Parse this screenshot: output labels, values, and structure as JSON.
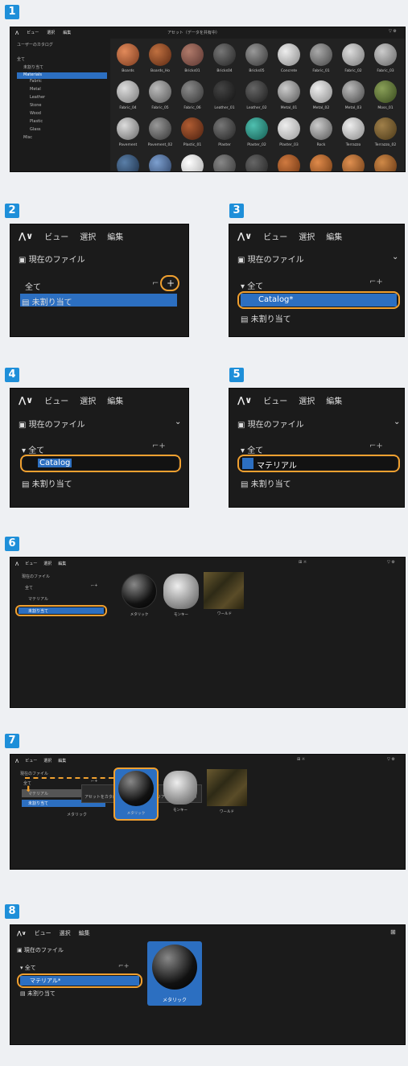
{
  "steps": [
    "1",
    "2",
    "3",
    "4",
    "5",
    "6",
    "7",
    "8"
  ],
  "s1": {
    "menu": [
      "ビュー",
      "選択",
      "編集"
    ],
    "title": "アセット（データを共有中）",
    "search_placeholder": "ユーザーのカタログ",
    "tree": [
      "全て",
      "未割り当て",
      "Materials",
      "Fabric",
      "Metal",
      "Leather",
      "Stone",
      "Wood",
      "Plastic",
      "Glass",
      "Misc"
    ],
    "materials_row1": [
      "Boards",
      "Boards_Ho",
      "Bricks01",
      "Bricks04",
      "Bricks05",
      "Concrete",
      "Fabric_01",
      "Fabric_02",
      "Fabric_03"
    ],
    "materials_row2": [
      "Fabric_04",
      "Fabric_05",
      "Fabric_06",
      "Leather_01",
      "Leather_02",
      "Metal_01",
      "Metal_02",
      "Metal_03",
      "Moss_01"
    ],
    "materials_row3": [
      "Pavement",
      "Pavement_02",
      "Plastic_01",
      "Plaster",
      "Plaster_02",
      "Plaster_03",
      "Rock",
      "Terrazzo",
      "Terrazzo_02"
    ]
  },
  "s2": {
    "menu": [
      "ビュー",
      "選択",
      "編集"
    ],
    "file": "現在のファイル",
    "all": "全て",
    "unassigned": "未割り当て"
  },
  "s3": {
    "menu": [
      "ビュー",
      "選択",
      "編集"
    ],
    "file": "現在のファイル",
    "all": "全て",
    "catalog": "Catalog*",
    "unassigned": "未割り当て"
  },
  "s4": {
    "menu": [
      "ビュー",
      "選択",
      "編集"
    ],
    "file": "現在のファイル",
    "all": "全て",
    "catalog": "Catalog",
    "unassigned": "未割り当て"
  },
  "s5": {
    "menu": [
      "ビュー",
      "選択",
      "編集"
    ],
    "file": "現在のファイル",
    "all": "全て",
    "catalog": "マテリアル",
    "unassigned": "未割り当て"
  },
  "s6": {
    "menu": [
      "ビュー",
      "選択",
      "編集"
    ],
    "file": "現在のファイル",
    "all": "全て",
    "catalog": "マテリアル",
    "unassigned": "未割り当て",
    "assets": [
      "メタリック",
      "モンキー",
      "ワールド"
    ]
  },
  "s7": {
    "menu": [
      "ビュー",
      "選択",
      "編集"
    ],
    "file": "現在のファイル",
    "all": "全て",
    "catalog": "マテリアル",
    "unassigned": "未割り当て",
    "tooltip": "アセットをカタログに移動します（マテリアル（ダイアログ））",
    "dragging": "メタリック",
    "assets": [
      "メタリック",
      "モンキー",
      "ワールド"
    ]
  },
  "s8": {
    "menu": [
      "ビュー",
      "選択",
      "編集"
    ],
    "file": "現在のファイル",
    "all": "全て",
    "catalog": "マテリアル*",
    "unassigned": "未割り当て",
    "asset": "メタリック"
  },
  "colors": {
    "accent": "#2c6fc1",
    "highlight": "#f0a030",
    "step": "#1e8fd9",
    "panel": "#1b1b1b"
  }
}
